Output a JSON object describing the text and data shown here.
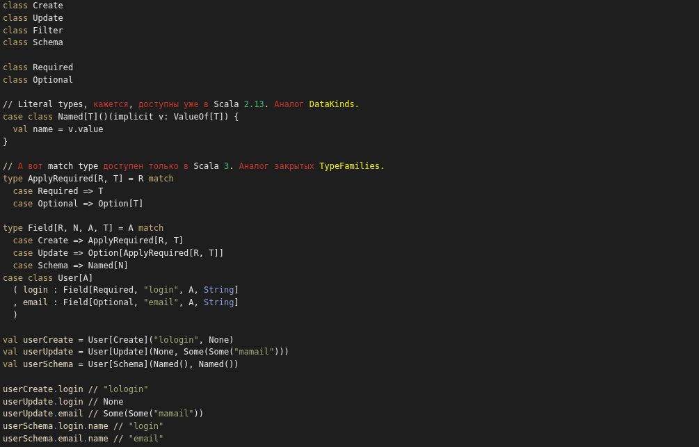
{
  "editor": {
    "lines": [
      {
        "kind": "code",
        "tokens": [
          {
            "kind": "keyword",
            "text": "class"
          },
          {
            "kind": "plain",
            "text": " Create"
          }
        ]
      },
      {
        "kind": "code",
        "tokens": [
          {
            "kind": "keyword",
            "text": "class"
          },
          {
            "kind": "plain",
            "text": " Update"
          }
        ]
      },
      {
        "kind": "code",
        "tokens": [
          {
            "kind": "keyword",
            "text": "class"
          },
          {
            "kind": "plain",
            "text": " Filter"
          }
        ]
      },
      {
        "kind": "code",
        "tokens": [
          {
            "kind": "keyword",
            "text": "class"
          },
          {
            "kind": "plain",
            "text": " Schema"
          }
        ]
      },
      {
        "kind": "blank"
      },
      {
        "kind": "code",
        "tokens": [
          {
            "kind": "keyword",
            "text": "class"
          },
          {
            "kind": "plain",
            "text": " Required"
          }
        ]
      },
      {
        "kind": "code",
        "tokens": [
          {
            "kind": "keyword",
            "text": "class"
          },
          {
            "kind": "plain",
            "text": " Optional"
          }
        ]
      },
      {
        "kind": "blank"
      },
      {
        "kind": "code",
        "tokens": [
          {
            "kind": "comment-mark",
            "text": "//"
          },
          {
            "kind": "plain",
            "text": " Literal types, "
          },
          {
            "kind": "accent",
            "text": "кажется"
          },
          {
            "kind": "plain",
            "text": ", "
          },
          {
            "kind": "accent",
            "text": "доступны уже в"
          },
          {
            "kind": "plain",
            "text": " Scala "
          },
          {
            "kind": "number",
            "text": "2.13"
          },
          {
            "kind": "plain",
            "text": ". "
          },
          {
            "kind": "accent",
            "text": "Аналог "
          },
          {
            "kind": "highlight",
            "text": "DataKinds."
          }
        ]
      },
      {
        "kind": "code",
        "tokens": [
          {
            "kind": "keyword",
            "text": "case class"
          },
          {
            "kind": "plain",
            "text": " Named[T]()(implicit v: ValueOf[T]) {"
          }
        ]
      },
      {
        "kind": "code",
        "tokens": [
          {
            "kind": "keyword",
            "text": "  val"
          },
          {
            "kind": "plain",
            "text": " name = v.value"
          }
        ]
      },
      {
        "kind": "code",
        "tokens": [
          {
            "kind": "plain",
            "text": "}"
          }
        ]
      },
      {
        "kind": "blank"
      },
      {
        "kind": "code",
        "tokens": [
          {
            "kind": "comment-mark",
            "text": "// "
          },
          {
            "kind": "accent",
            "text": "А вот"
          },
          {
            "kind": "plain",
            "text": " match type "
          },
          {
            "kind": "accent",
            "text": "доступен только в"
          },
          {
            "kind": "plain",
            "text": " Scala "
          },
          {
            "kind": "number",
            "text": "3"
          },
          {
            "kind": "plain",
            "text": ". "
          },
          {
            "kind": "accent",
            "text": "Аналог закрытых "
          },
          {
            "kind": "highlight",
            "text": "TypeFamilies."
          }
        ]
      },
      {
        "kind": "code",
        "tokens": [
          {
            "kind": "keyword",
            "text": "type"
          },
          {
            "kind": "plain",
            "text": " ApplyRequired[R, T] = R "
          },
          {
            "kind": "keyword",
            "text": "match"
          }
        ]
      },
      {
        "kind": "code",
        "tokens": [
          {
            "kind": "keyword",
            "text": "  case"
          },
          {
            "kind": "plain",
            "text": " Required => T"
          }
        ]
      },
      {
        "kind": "code",
        "tokens": [
          {
            "kind": "keyword",
            "text": "  case"
          },
          {
            "kind": "plain",
            "text": " Optional => Option[T]"
          }
        ]
      },
      {
        "kind": "blank"
      },
      {
        "kind": "code",
        "tokens": [
          {
            "kind": "keyword",
            "text": "type"
          },
          {
            "kind": "plain",
            "text": " Field[R, N, A, T] = A "
          },
          {
            "kind": "keyword",
            "text": "match"
          }
        ]
      },
      {
        "kind": "code",
        "tokens": [
          {
            "kind": "keyword",
            "text": "  case"
          },
          {
            "kind": "plain",
            "text": " Create => ApplyRequired[R, T]"
          }
        ]
      },
      {
        "kind": "code",
        "tokens": [
          {
            "kind": "keyword",
            "text": "  case"
          },
          {
            "kind": "plain",
            "text": " Update => Option[ApplyRequired[R, T]]"
          }
        ]
      },
      {
        "kind": "code",
        "tokens": [
          {
            "kind": "keyword",
            "text": "  case"
          },
          {
            "kind": "plain",
            "text": " Schema => Named[N]"
          }
        ]
      },
      {
        "kind": "code",
        "tokens": [
          {
            "kind": "keyword",
            "text": "case class"
          },
          {
            "kind": "plain",
            "text": " User[A]"
          }
        ]
      },
      {
        "kind": "code",
        "tokens": [
          {
            "kind": "plain",
            "text": "  ( "
          },
          {
            "kind": "identifier",
            "text": "login"
          },
          {
            "kind": "plain",
            "text": " : Field[Required, "
          },
          {
            "kind": "string",
            "text": "\"login\""
          },
          {
            "kind": "plain",
            "text": ", A, "
          },
          {
            "kind": "type",
            "text": "String"
          },
          {
            "kind": "plain",
            "text": "]"
          }
        ]
      },
      {
        "kind": "code",
        "tokens": [
          {
            "kind": "plain",
            "text": "  , "
          },
          {
            "kind": "identifier",
            "text": "email"
          },
          {
            "kind": "plain",
            "text": " : Field[Optional, "
          },
          {
            "kind": "string",
            "text": "\"email\""
          },
          {
            "kind": "plain",
            "text": ", A, "
          },
          {
            "kind": "type",
            "text": "String"
          },
          {
            "kind": "plain",
            "text": "]"
          }
        ]
      },
      {
        "kind": "code",
        "tokens": [
          {
            "kind": "plain",
            "text": "  )"
          }
        ]
      },
      {
        "kind": "blank"
      },
      {
        "kind": "code",
        "tokens": [
          {
            "kind": "keyword",
            "text": "val"
          },
          {
            "kind": "identifier",
            "text": " userCreate"
          },
          {
            "kind": "plain",
            "text": " = User[Create]("
          },
          {
            "kind": "string",
            "text": "\"lologin\""
          },
          {
            "kind": "plain",
            "text": ", None)"
          }
        ]
      },
      {
        "kind": "code",
        "tokens": [
          {
            "kind": "keyword",
            "text": "val"
          },
          {
            "kind": "identifier",
            "text": " userUpdate"
          },
          {
            "kind": "plain",
            "text": " = User[Update](None, Some(Some("
          },
          {
            "kind": "string",
            "text": "\"mamail\""
          },
          {
            "kind": "plain",
            "text": ")))"
          }
        ]
      },
      {
        "kind": "code",
        "tokens": [
          {
            "kind": "keyword",
            "text": "val"
          },
          {
            "kind": "identifier",
            "text": " userSchema"
          },
          {
            "kind": "plain",
            "text": " = User[Schema](Named(), Named())"
          }
        ]
      },
      {
        "kind": "blank"
      },
      {
        "kind": "code",
        "tokens": [
          {
            "kind": "identifier",
            "text": "userCreate"
          },
          {
            "kind": "dot",
            "text": "."
          },
          {
            "kind": "identifier",
            "text": "login"
          },
          {
            "kind": "comment-mark",
            "text": " // "
          },
          {
            "kind": "string",
            "text": "\"lologin\""
          }
        ]
      },
      {
        "kind": "code",
        "tokens": [
          {
            "kind": "identifier",
            "text": "userUpdate"
          },
          {
            "kind": "dot",
            "text": "."
          },
          {
            "kind": "identifier",
            "text": "login"
          },
          {
            "kind": "comment-mark",
            "text": " //"
          },
          {
            "kind": "plain",
            "text": " None"
          }
        ]
      },
      {
        "kind": "code",
        "tokens": [
          {
            "kind": "identifier",
            "text": "userUpdate"
          },
          {
            "kind": "dot",
            "text": "."
          },
          {
            "kind": "identifier",
            "text": "email"
          },
          {
            "kind": "comment-mark",
            "text": " //"
          },
          {
            "kind": "plain",
            "text": " Some(Some("
          },
          {
            "kind": "string",
            "text": "\"mamail\""
          },
          {
            "kind": "plain",
            "text": "))"
          }
        ]
      },
      {
        "kind": "code",
        "tokens": [
          {
            "kind": "identifier",
            "text": "userSchema"
          },
          {
            "kind": "dot",
            "text": "."
          },
          {
            "kind": "identifier",
            "text": "login"
          },
          {
            "kind": "dot",
            "text": "."
          },
          {
            "kind": "identifier",
            "text": "name"
          },
          {
            "kind": "comment-mark",
            "text": " // "
          },
          {
            "kind": "string",
            "text": "\"login\""
          }
        ]
      },
      {
        "kind": "code",
        "tokens": [
          {
            "kind": "identifier",
            "text": "userSchema"
          },
          {
            "kind": "dot",
            "text": "."
          },
          {
            "kind": "identifier",
            "text": "email"
          },
          {
            "kind": "dot",
            "text": "."
          },
          {
            "kind": "identifier",
            "text": "name"
          },
          {
            "kind": "comment-mark",
            "text": " // "
          },
          {
            "kind": "string",
            "text": "\"email\""
          }
        ]
      }
    ]
  }
}
